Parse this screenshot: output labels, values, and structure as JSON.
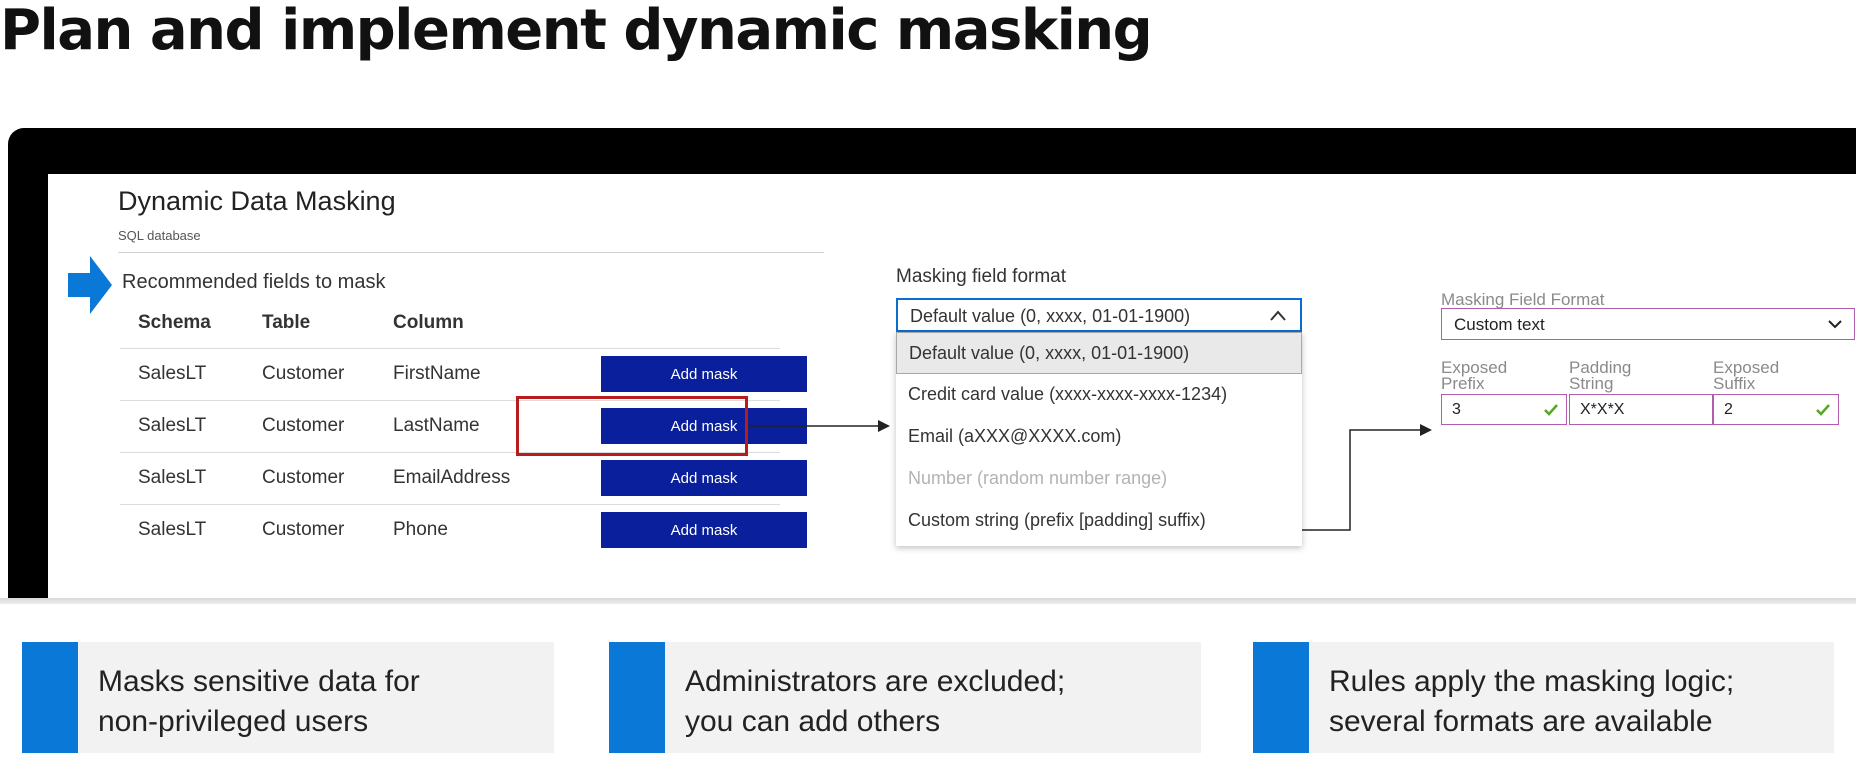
{
  "slide": {
    "title": "Plan and implement dynamic masking"
  },
  "blade": {
    "title": "Dynamic Data Masking",
    "subtitle": "SQL database",
    "section_label": "Recommended fields to mask"
  },
  "table": {
    "headers": [
      "Schema",
      "Table",
      "Column"
    ],
    "rows": [
      {
        "schema": "SalesLT",
        "table": "Customer",
        "column": "FirstName",
        "action": "Add mask"
      },
      {
        "schema": "SalesLT",
        "table": "Customer",
        "column": "LastName",
        "action": "Add mask"
      },
      {
        "schema": "SalesLT",
        "table": "Customer",
        "column": "EmailAddress",
        "action": "Add mask"
      },
      {
        "schema": "SalesLT",
        "table": "Customer",
        "column": "Phone",
        "action": "Add mask"
      }
    ],
    "highlighted_row": 1
  },
  "masking_format": {
    "label": "Masking field format",
    "selected": "Default value (0, xxxx, 01-01-1900)",
    "options": [
      "Default value (0, xxxx, 01-01-1900)",
      "Credit card value (xxxx-xxxx-xxxx-1234)",
      "Email (aXXX@XXXX.com)",
      "Number (random number range)",
      "Custom string (prefix [padding] suffix)"
    ],
    "disabled_option_index": 3
  },
  "custom_config": {
    "format_label": "Masking Field Format",
    "format_value": "Custom text",
    "prefix_label": [
      "Exposed",
      "Prefix"
    ],
    "prefix_value": "3",
    "padding_label": [
      "Padding",
      "String"
    ],
    "padding_value": "X*X*X",
    "suffix_label": [
      "Exposed",
      "Suffix"
    ],
    "suffix_value": "2"
  },
  "cards": [
    {
      "lines": [
        "Masks sensitive data for",
        "non-privileged users"
      ]
    },
    {
      "lines": [
        "Administrators are excluded;",
        "you can add others"
      ]
    },
    {
      "lines": [
        "Rules apply the masking logic;",
        "several formats are available"
      ]
    }
  ],
  "colors": {
    "button_bg": "#0a1f9b",
    "accent_blue": "#0a78d7",
    "highlight_red": "#b81c1c",
    "field_border": "#b05db0",
    "check_green": "#5aa623"
  },
  "icons": {
    "pointer": "arrow-right-icon",
    "dropdown_open": "chevron-up-icon",
    "dropdown_closed": "chevron-down-icon",
    "valid": "checkmark-icon"
  }
}
